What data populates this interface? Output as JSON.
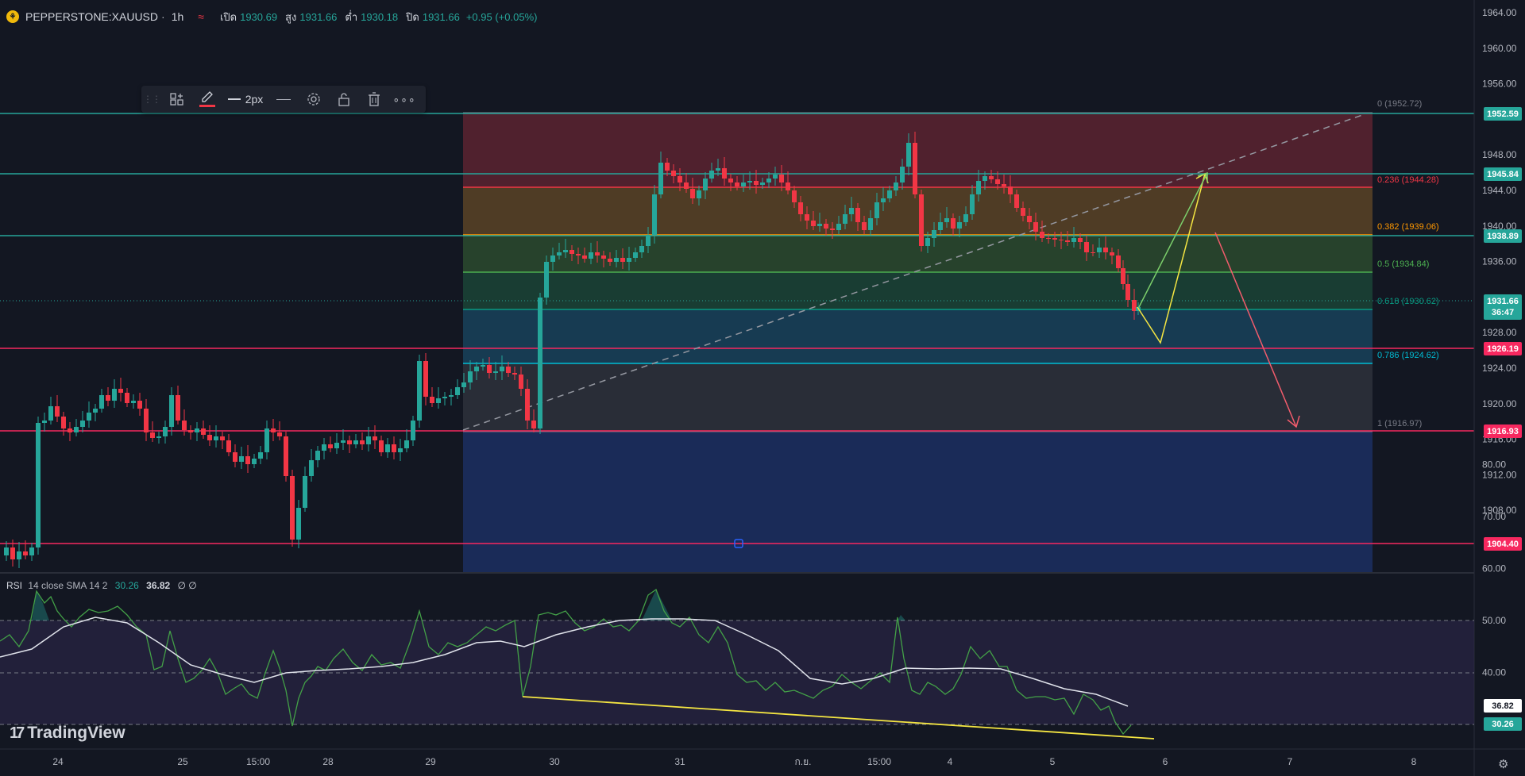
{
  "legend": {
    "symbol": "PEPPERSTONE:XAUUSD",
    "dot": "·",
    "timeframe": "1h",
    "open_label": "เปิด",
    "open": "1930.69",
    "high_label": "สูง",
    "high": "1931.66",
    "low_label": "ต่ำ",
    "low": "1930.18",
    "close_label": "ปิด",
    "close": "1931.66",
    "change": "+0.95 (+0.05%)"
  },
  "toolbar": {
    "width_label": "2px"
  },
  "price_axis": {
    "ticks": [
      "1964.00",
      "1960.00",
      "1956.00",
      "1948.00",
      "1944.00",
      "1940.00",
      "1936.00",
      "1928.00",
      "1924.00",
      "1920.00",
      "1916.00",
      "1912.00",
      "1908.00"
    ]
  },
  "price_tags": {
    "p1952": "1952.59",
    "p1945": "1945.84",
    "p1938": "1938.89",
    "p1926": "1926.19",
    "p1916": "1916.93",
    "p1904": "1904.40",
    "current_price": "1931.66",
    "countdown": "36:47"
  },
  "fib_labels": {
    "l0": "0 (1952.72)",
    "l236": "0.236 (1944.28)",
    "l382": "0.382 (1939.06)",
    "l5": "0.5 (1934.84)",
    "l618": "0.618 (1930.62)",
    "l786": "0.786 (1924.62)",
    "l1": "1 (1916.97)"
  },
  "rsi": {
    "title": "RSI",
    "params": "14 close SMA 14 2",
    "rsi_value": "30.26",
    "sma_value": "36.82",
    "extra": "∅ ∅",
    "axis": [
      "80.00",
      "70.00",
      "60.00",
      "50.00",
      "40.00"
    ],
    "tag_sma": "36.82",
    "tag_rsi": "30.26"
  },
  "time_axis": [
    "24",
    "25",
    "15:00",
    "28",
    "29",
    "30",
    "31",
    "ก.ย.",
    "15:00",
    "4",
    "5",
    "6",
    "7",
    "8"
  ],
  "brand": {
    "name": "TradingView",
    "mark": "17"
  },
  "colors": {
    "up": "#26a69a",
    "down": "#f23645",
    "background": "#131722",
    "teal_line": "#26a69a",
    "pink_line": "#f7285f",
    "yellow": "#f5e642"
  }
}
